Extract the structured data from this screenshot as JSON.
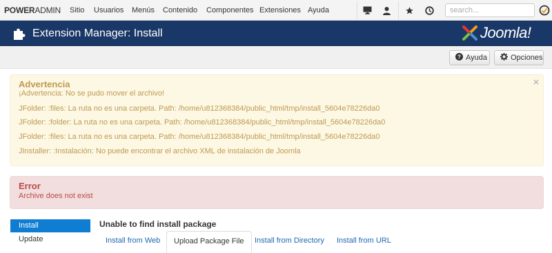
{
  "topnav": {
    "brand_main": "POWER",
    "brand_accent": "ADMIN",
    "menu": [
      "Sitio",
      "Usuarios",
      "Menús",
      "Contenido",
      "Componentes",
      "Extensiones",
      "Ayuda"
    ],
    "search_placeholder": "search...",
    "icons": [
      "monitor-icon",
      "user-icon",
      "star-icon",
      "clock-icon",
      "joomla-badge-icon"
    ]
  },
  "header": {
    "title": "Extension Manager: Install",
    "logo_text": "Joomla!",
    "colors": {
      "bar": "#1a3867",
      "logo_red": "#e8382d",
      "logo_orange": "#f39c21",
      "logo_green": "#7ac143",
      "logo_blue": "#5091cd"
    }
  },
  "toolbar": {
    "help_label": "Ayuda",
    "options_label": "Opciones"
  },
  "warning": {
    "heading": "Advertencia",
    "messages": [
      "¡Advertencia: No se pudo mover el archivo!",
      "JFolder: :files: La ruta no es una carpeta. Path: /home/u812368384/public_html/tmp/install_5604e78226da0",
      "JFolder: :folder: La ruta no es una carpeta. Path: /home/u812368384/public_html/tmp/install_5604e78226da0",
      "JFolder: :files: La ruta no es una carpeta. Path: /home/u812368384/public_html/tmp/install_5604e78226da0",
      "JInstaller: :Instalación: No puede encontrar el archivo XML de instalación de Joomla"
    ],
    "close": "×"
  },
  "error": {
    "heading": "Error",
    "message": "Archive does not exist"
  },
  "sidebar": {
    "items": [
      {
        "label": "Install",
        "active": true
      },
      {
        "label": "Update",
        "active": false
      }
    ]
  },
  "main": {
    "heading": "Unable to find install package",
    "tabs": [
      {
        "label": "Install from Web",
        "active": false
      },
      {
        "label": "Upload Package File",
        "active": true
      },
      {
        "label": "Install from Directory",
        "active": false
      },
      {
        "label": "Install from URL",
        "active": false
      }
    ]
  }
}
